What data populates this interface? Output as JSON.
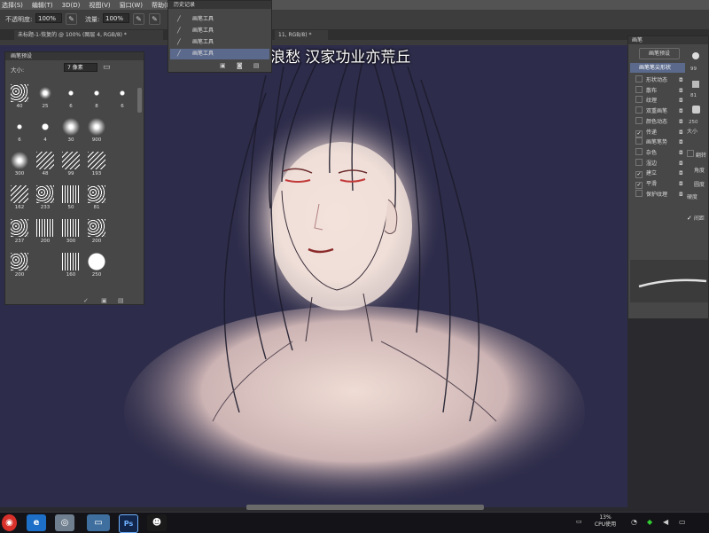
{
  "menubar": [
    "选择(S)",
    "编辑(T)",
    "3D(D)",
    "视图(V)",
    "窗口(W)",
    "帮助(H)"
  ],
  "options": {
    "opacity_label": "不透明度:",
    "opacity_value": "100%",
    "flow_label": "流量:",
    "flow_value": "100%"
  },
  "tabs": [
    "未标题-1-恢复的 @ 100% (图层 4, RGB/8) *",
    "11, RGB/8) *"
  ],
  "caption": "千载兴亡莫浪愁 汉家功业亦荒丘",
  "brush_panel": {
    "title": "画笔预设",
    "size_label": "大小:",
    "size_value": "7 像素",
    "cells": [
      {
        "num": "40"
      },
      {
        "num": "25"
      },
      {
        "num": "6"
      },
      {
        "num": "8"
      },
      {
        "num": "6"
      },
      {
        "num": "6"
      },
      {
        "num": "4"
      },
      {
        "num": "30"
      },
      {
        "num": "900"
      },
      {
        "num": ""
      },
      {
        "num": "300"
      },
      {
        "num": "48"
      },
      {
        "num": "99"
      },
      {
        "num": "193"
      },
      {
        "num": ""
      },
      {
        "num": "162"
      },
      {
        "num": "233"
      },
      {
        "num": "50"
      },
      {
        "num": "81"
      },
      {
        "num": ""
      },
      {
        "num": "237"
      },
      {
        "num": "200"
      },
      {
        "num": "300"
      },
      {
        "num": "200"
      },
      {
        "num": ""
      },
      {
        "num": "200"
      },
      {
        "num": ""
      },
      {
        "num": "160"
      },
      {
        "num": "250"
      },
      {
        "num": ""
      }
    ]
  },
  "history": {
    "title": "历史记录",
    "items": [
      "画笔工具",
      "画笔工具",
      "画笔工具",
      "画笔工具"
    ]
  },
  "brush_settings": {
    "tab": "画笔",
    "preset_button": "画笔预设",
    "selected": "画笔笔尖形状",
    "items": [
      {
        "label": "形状动态",
        "checked": false
      },
      {
        "label": "散布",
        "checked": false
      },
      {
        "label": "纹理",
        "checked": false
      },
      {
        "label": "双重画笔",
        "checked": false
      },
      {
        "label": "颜色动态",
        "checked": false
      },
      {
        "label": "传递",
        "checked": true
      },
      {
        "label": "画笔笔势",
        "checked": false
      },
      {
        "label": "杂色",
        "checked": false
      },
      {
        "label": "湿边",
        "checked": false
      },
      {
        "label": "建立",
        "checked": true
      },
      {
        "label": "平滑",
        "checked": true
      },
      {
        "label": "保护纹理",
        "checked": false
      }
    ],
    "size_label": "大小",
    "flip_label": "翻转",
    "angle_label": "角度",
    "roundness_label": "圆度",
    "hardness_label": "硬度",
    "spacing_label": "间距",
    "tip_numbers": [
      "99",
      "81",
      "250"
    ]
  },
  "taskbar": {
    "cpu_percent": "13%",
    "cpu_label": "CPU使用"
  },
  "colors": {
    "canvas_bg": "#2d2c4a",
    "panel_bg": "#474747",
    "menubar_bg": "#535353"
  }
}
